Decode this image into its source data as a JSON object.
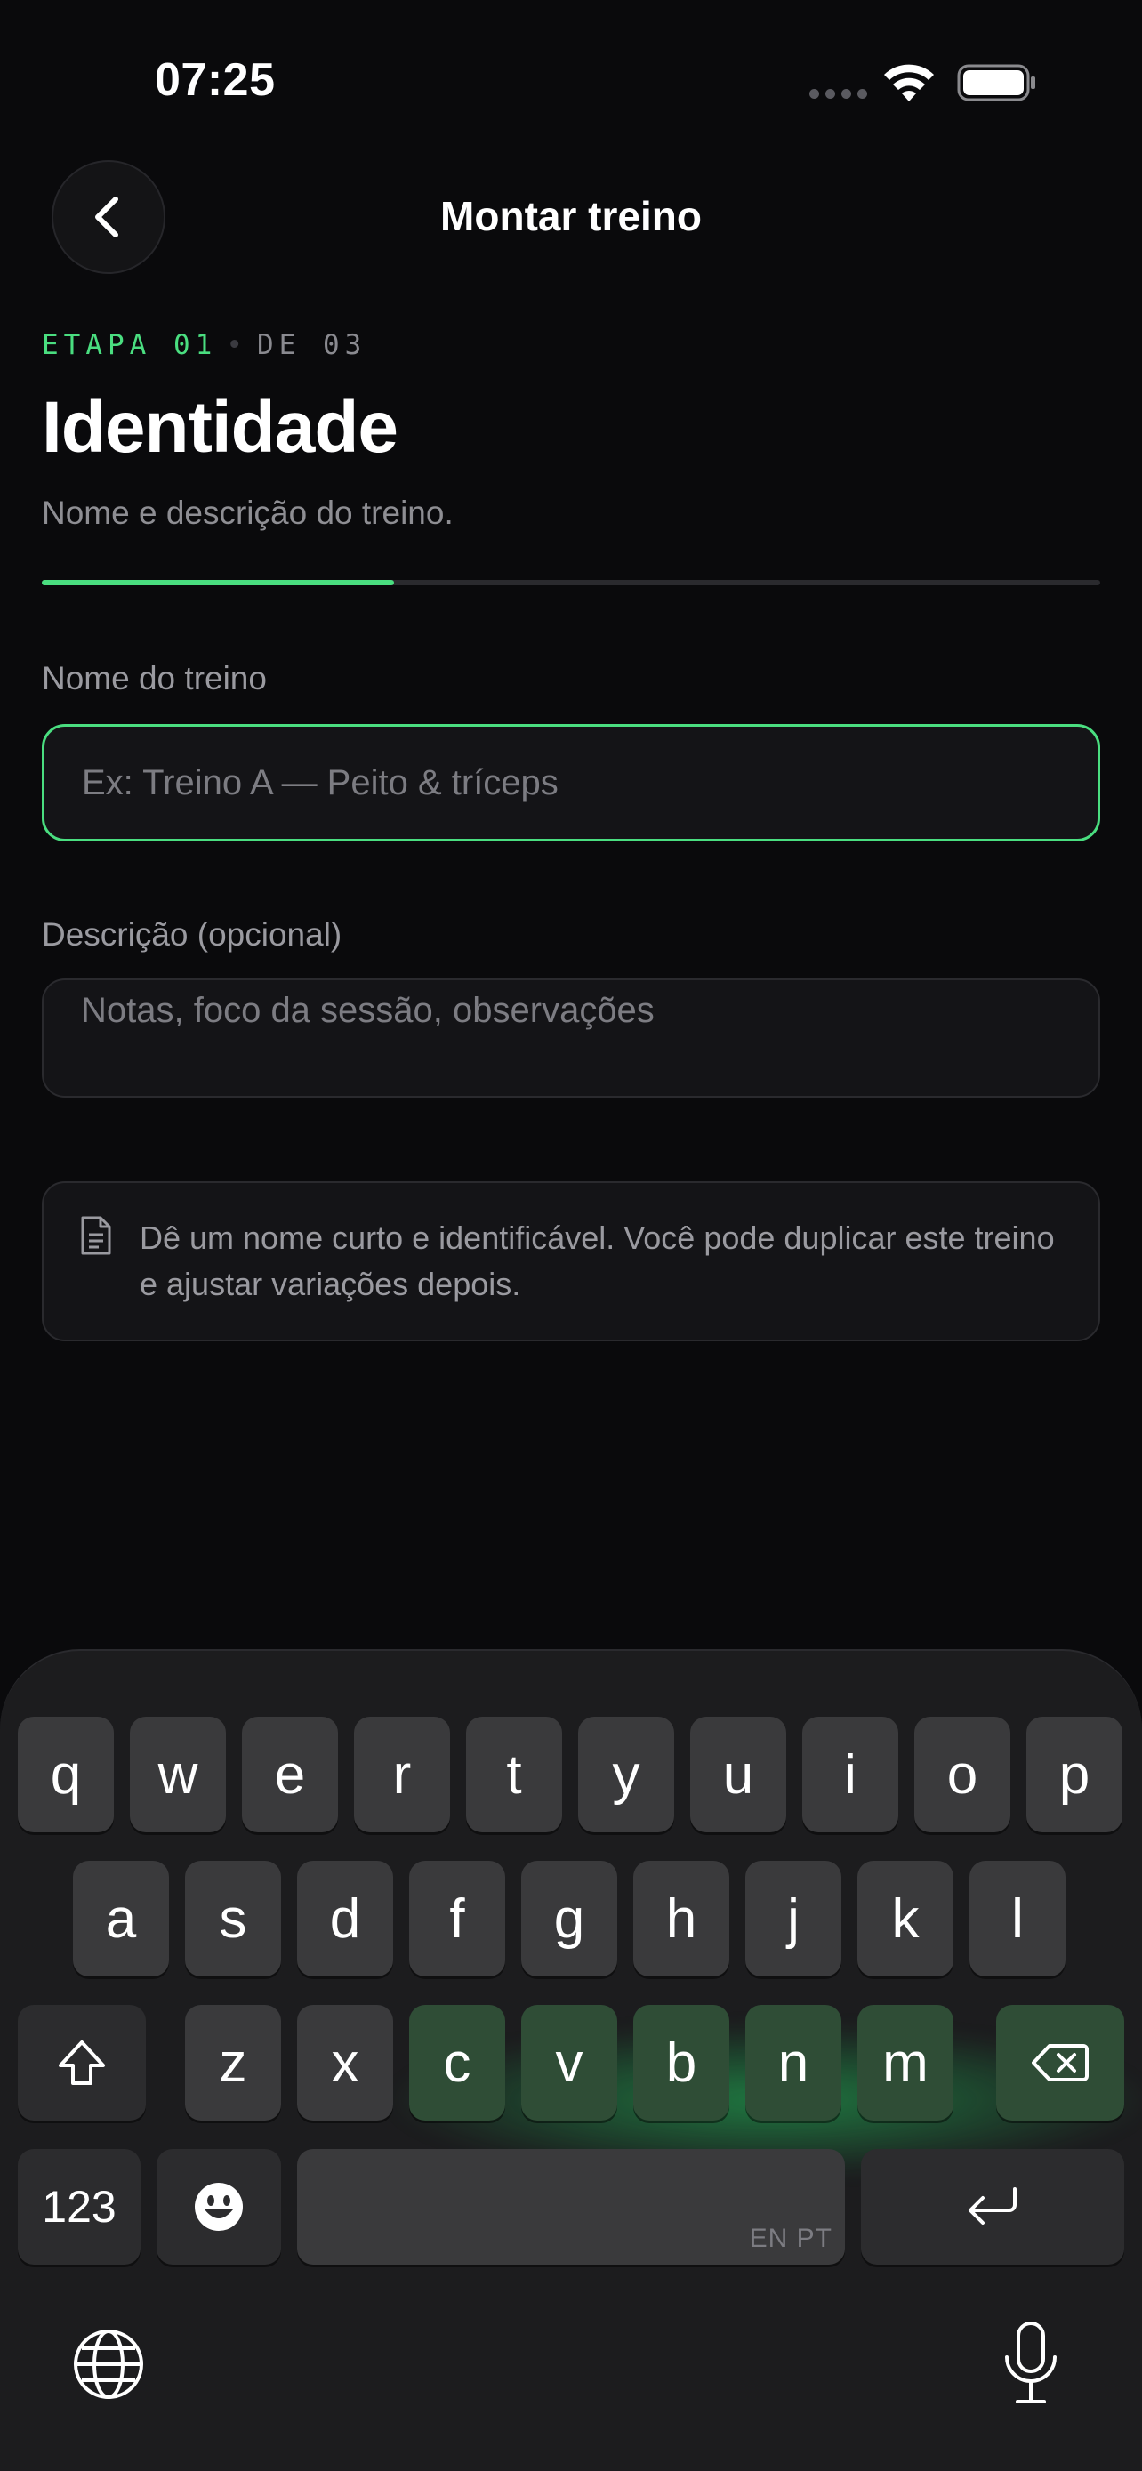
{
  "status_bar": {
    "time": "07:25"
  },
  "header": {
    "title": "Montar treino",
    "back_icon": "chevron-left-icon"
  },
  "step": {
    "label": "ETAPA 01",
    "separator": "•",
    "total": "DE 03",
    "title": "Identidade",
    "subtitle": "Nome e descrição do treino.",
    "progress": 0.333
  },
  "form": {
    "name_label": "Nome do treino",
    "name_placeholder": "Ex: Treino A — Peito & tríceps",
    "description_label": "Descrição (opcional)",
    "description_placeholder": "Notas, foco da sessão, observações"
  },
  "hint": {
    "icon": "document-icon",
    "text": "Dê um nome curto e identificável. Você pode duplicar este treino e ajustar variações depois."
  },
  "keyboard": {
    "row1": [
      "q",
      "w",
      "e",
      "r",
      "t",
      "y",
      "u",
      "i",
      "o",
      "p"
    ],
    "row2": [
      "a",
      "s",
      "d",
      "f",
      "g",
      "h",
      "j",
      "k",
      "l"
    ],
    "row3": [
      "z",
      "x",
      "c",
      "v",
      "b",
      "n",
      "m"
    ],
    "numbers_key": "123",
    "language_label": "EN PT"
  },
  "colors": {
    "accent": "#4ade80",
    "background": "#0a0a0c",
    "surface": "#141417"
  }
}
